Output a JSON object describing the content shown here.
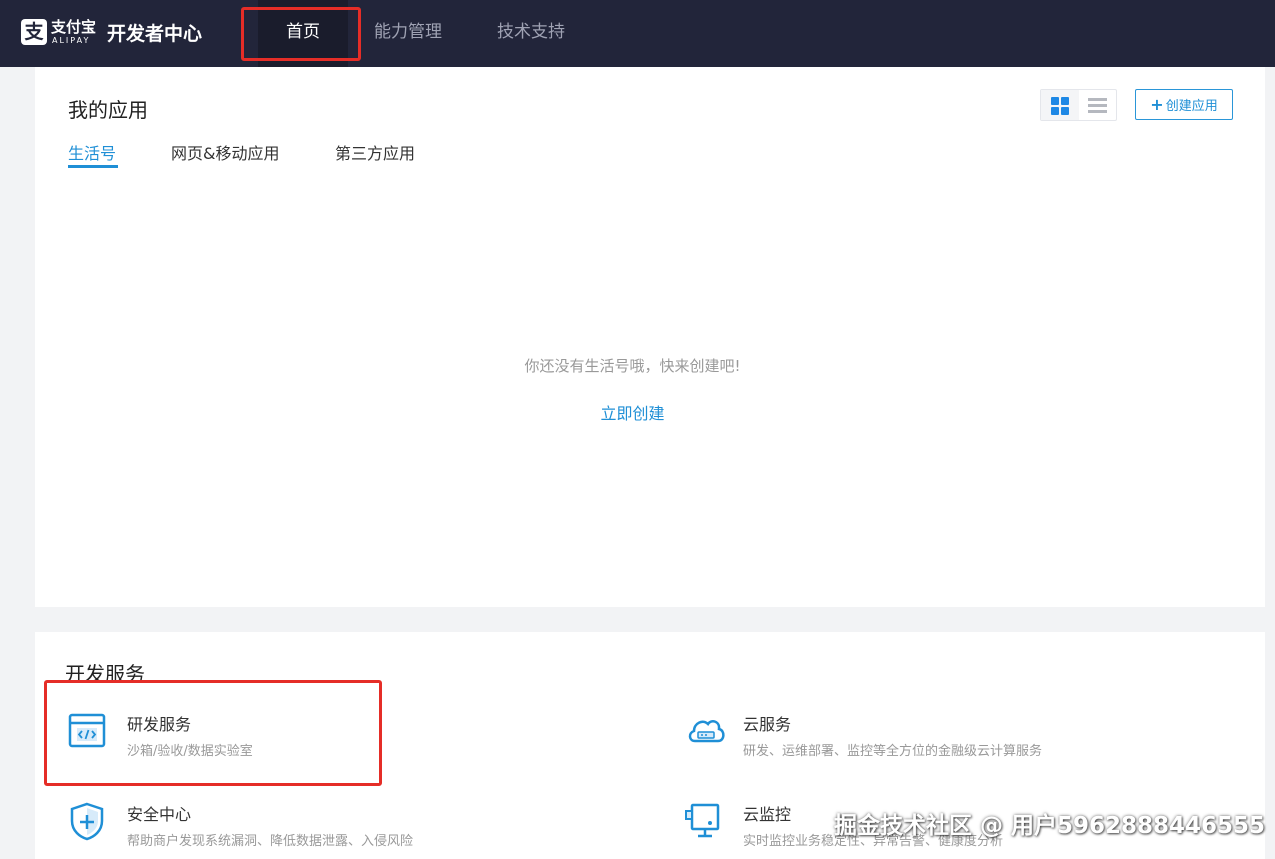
{
  "header": {
    "logo": {
      "zh": "支付宝",
      "en": "ALIPAY",
      "glyph": "支"
    },
    "site_title": "开发者中心",
    "nav": [
      {
        "label": "首页",
        "active": true
      },
      {
        "label": "能力管理",
        "active": false
      },
      {
        "label": "技术支持",
        "active": false
      }
    ]
  },
  "my_apps": {
    "title": "我的应用",
    "create_button": {
      "icon": "plus-icon",
      "label": "创建应用"
    },
    "view_toggle": {
      "selected": "grid",
      "options": [
        "grid-view-icon",
        "list-view-icon"
      ]
    },
    "tabs": [
      {
        "label": "生活号",
        "active": true
      },
      {
        "label": "网页&移动应用",
        "active": false
      },
      {
        "label": "第三方应用",
        "active": false
      }
    ],
    "empty_state": {
      "message": "你还没有生活号哦，快来创建吧!",
      "action": "立即创建"
    }
  },
  "dev_services": {
    "title": "开发服务",
    "items": [
      {
        "title": "研发服务",
        "desc": "沙箱/验收/数据实验室",
        "icon": "code-window-icon"
      },
      {
        "title": "云服务",
        "desc": "研发、运维部署、监控等全方位的金融级云计算服务",
        "icon": "cloud-icon"
      },
      {
        "title": "安全中心",
        "desc": "帮助商户发现系统漏洞、降低数据泄露、入侵风险",
        "icon": "shield-plus-icon"
      },
      {
        "title": "云监控",
        "desc": "实时监控业务稳定性、异常告警、健康度分析",
        "icon": "monitor-icon"
      }
    ]
  },
  "watermark": "掘金技术社区 @ 用户5962888446555",
  "colors": {
    "topbar": "#22253a",
    "accent": "#1f8fd6",
    "highlight": "#e52d27",
    "background": "#f2f3f5"
  }
}
